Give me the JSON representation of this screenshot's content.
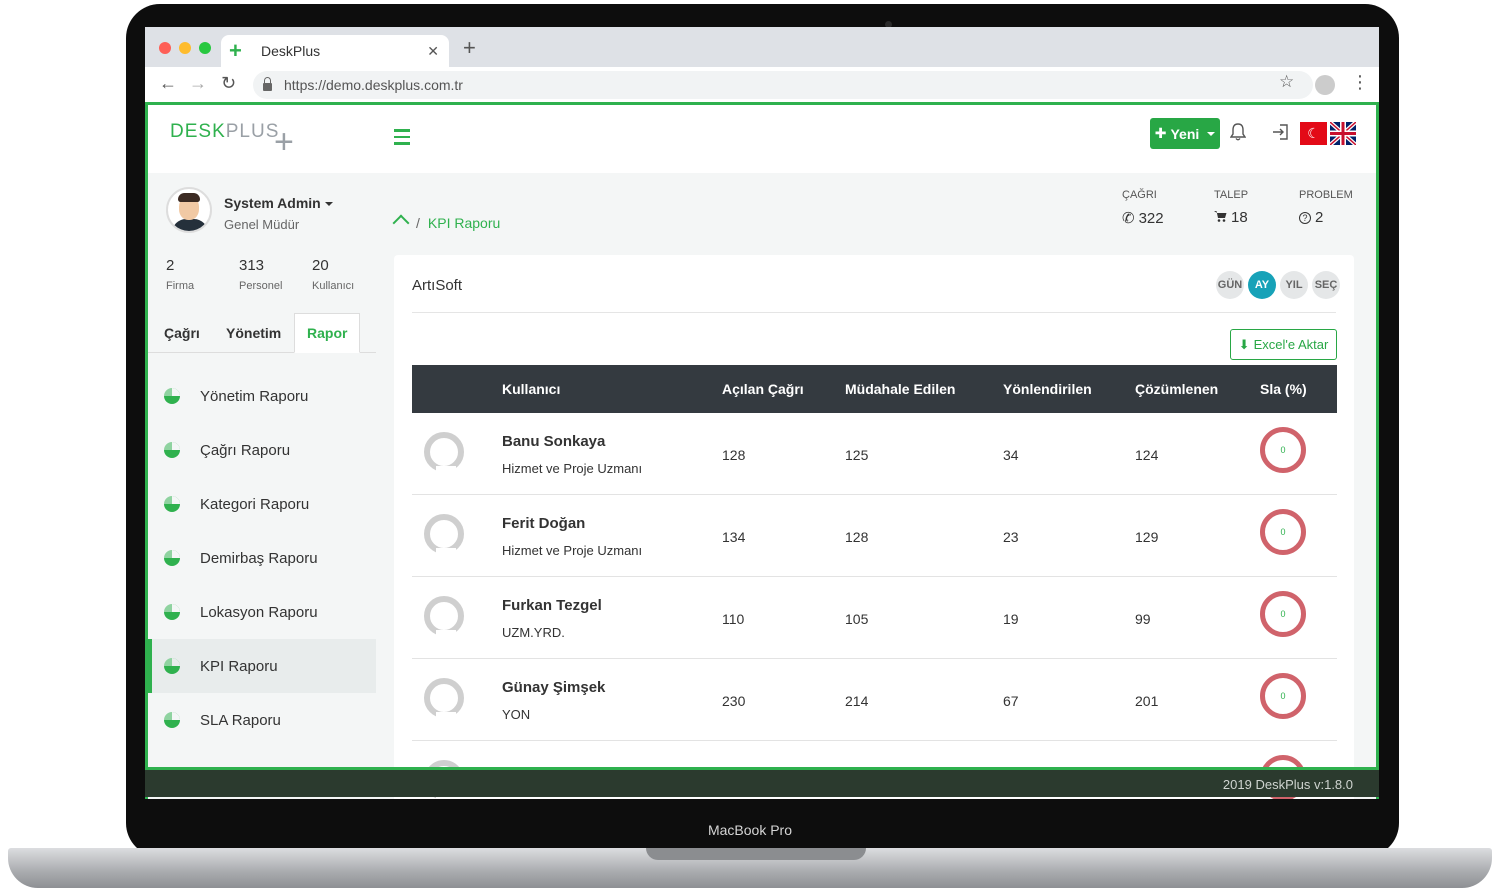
{
  "device_label": "MacBook Pro",
  "browser": {
    "tab_title": "DeskPlus",
    "url": "https://demo.deskplus.com.tr"
  },
  "app": {
    "logo_desk": "DESK",
    "logo_plus": "PLUS",
    "new_button": "Yeni",
    "accent_color": "#2fb14e"
  },
  "user": {
    "name": "System Admin",
    "role": "Genel Müdür",
    "stats": [
      {
        "value": "2",
        "label": "Firma"
      },
      {
        "value": "313",
        "label": "Personel"
      },
      {
        "value": "20",
        "label": "Kullanıcı"
      }
    ]
  },
  "sidebar": {
    "tabs": [
      "Çağrı",
      "Yönetim",
      "Rapor"
    ],
    "active_tab": "Rapor",
    "items": [
      "Yönetim Raporu",
      "Çağrı Raporu",
      "Kategori Raporu",
      "Demirbaş Raporu",
      "Lokasyon Raporu",
      "KPI Raporu",
      "SLA Raporu"
    ],
    "active_item": "KPI Raporu"
  },
  "breadcrumb": {
    "current": "KPI Raporu"
  },
  "counters": [
    {
      "label": "ÇAĞRI",
      "value": "322"
    },
    {
      "label": "TALEP",
      "value": "18"
    },
    {
      "label": "PROBLEM",
      "value": "2"
    }
  ],
  "card": {
    "title": "ArtıSoft",
    "periods": [
      "GÜN",
      "AY",
      "YIL",
      "SEÇ"
    ],
    "active_period": "AY",
    "excel_button": "Excel'e Aktar",
    "columns": [
      "Kullanıcı",
      "Açılan Çağrı",
      "Müdahale Edilen",
      "Yönlendirilen",
      "Çözümlenen",
      "Sla (%)"
    ],
    "rows": [
      {
        "name": "Banu Sonkaya",
        "title": "Hizmet ve Proje Uzmanı",
        "opened": "128",
        "handled": "125",
        "routed": "34",
        "resolved": "124",
        "sla": "0"
      },
      {
        "name": "Ferit Doğan",
        "title": "Hizmet ve Proje Uzmanı",
        "opened": "134",
        "handled": "128",
        "routed": "23",
        "resolved": "129",
        "sla": "0"
      },
      {
        "name": "Furkan Tezgel",
        "title": "UZM.YRD.",
        "opened": "110",
        "handled": "105",
        "routed": "19",
        "resolved": "99",
        "sla": "0"
      },
      {
        "name": "Günay Şimşek",
        "title": "YON",
        "opened": "230",
        "handled": "214",
        "routed": "67",
        "resolved": "201",
        "sla": "0"
      }
    ]
  },
  "footer": "2019 DeskPlus v:1.8.0"
}
